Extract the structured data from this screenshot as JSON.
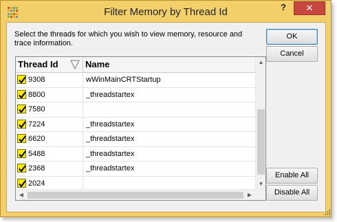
{
  "window": {
    "title": "Filter Memory by Thread Id",
    "help_label": "?",
    "close_label": "✕",
    "frame_color": "#f3cf6a"
  },
  "instructions": "Select the threads for which you wish to view memory, resource and trace information.",
  "buttons": {
    "ok": "OK",
    "cancel": "Cancel",
    "enable_all": "Enable All",
    "disable_all": "Disable All"
  },
  "grid": {
    "columns": [
      "Thread Id",
      "Name"
    ],
    "sort_column": "Thread Id",
    "rows": [
      {
        "id": "9308",
        "name": "wWinMainCRTStartup",
        "checked": true
      },
      {
        "id": "8800",
        "name": "_threadstartex",
        "checked": true
      },
      {
        "id": "7580",
        "name": "",
        "checked": true
      },
      {
        "id": "7224",
        "name": "_threadstartex",
        "checked": true
      },
      {
        "id": "6620",
        "name": "_threadstartex",
        "checked": true
      },
      {
        "id": "5488",
        "name": "_threadstartex",
        "checked": true
      },
      {
        "id": "2368",
        "name": "_threadstartex",
        "checked": true
      },
      {
        "id": "2024",
        "name": "",
        "checked": true
      }
    ]
  },
  "icons": {
    "app": "app-grid-icon",
    "sort": "sort-triangle-icon",
    "check": "check-icon"
  }
}
